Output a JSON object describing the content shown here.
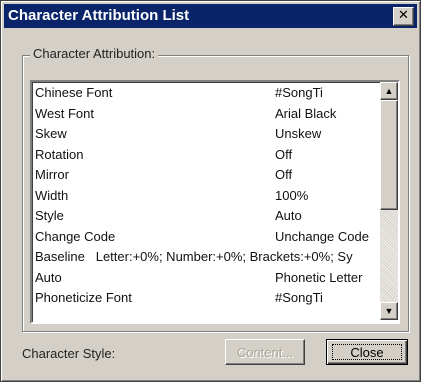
{
  "window": {
    "title": "Character Attribution List",
    "close_glyph": "✕"
  },
  "group": {
    "label": "Character Attribution:"
  },
  "attributes": [
    {
      "name": "Chinese Font",
      "value": "#SongTi"
    },
    {
      "name": "West Font",
      "value": "Arial Black"
    },
    {
      "name": "Skew",
      "value": "Unskew"
    },
    {
      "name": "Rotation",
      "value": "Off"
    },
    {
      "name": "Mirror",
      "value": "Off"
    },
    {
      "name": "Width",
      "value": "100%"
    },
    {
      "name": "Style",
      "value": "Auto"
    },
    {
      "name": "Change Code",
      "value": "Unchange Code"
    },
    {
      "name": "Baseline",
      "value": "Letter:+0%; Number:+0%; Brackets:+0%; Sy"
    },
    {
      "name": "Auto",
      "value": "Phonetic Letter"
    },
    {
      "name": "Phoneticize Font",
      "value": "#SongTi"
    }
  ],
  "scrollbar": {
    "up_glyph": "▲",
    "down_glyph": "▼"
  },
  "footer": {
    "style_label": "Character Style:",
    "content_button": "Content...",
    "close_button": "Close"
  }
}
